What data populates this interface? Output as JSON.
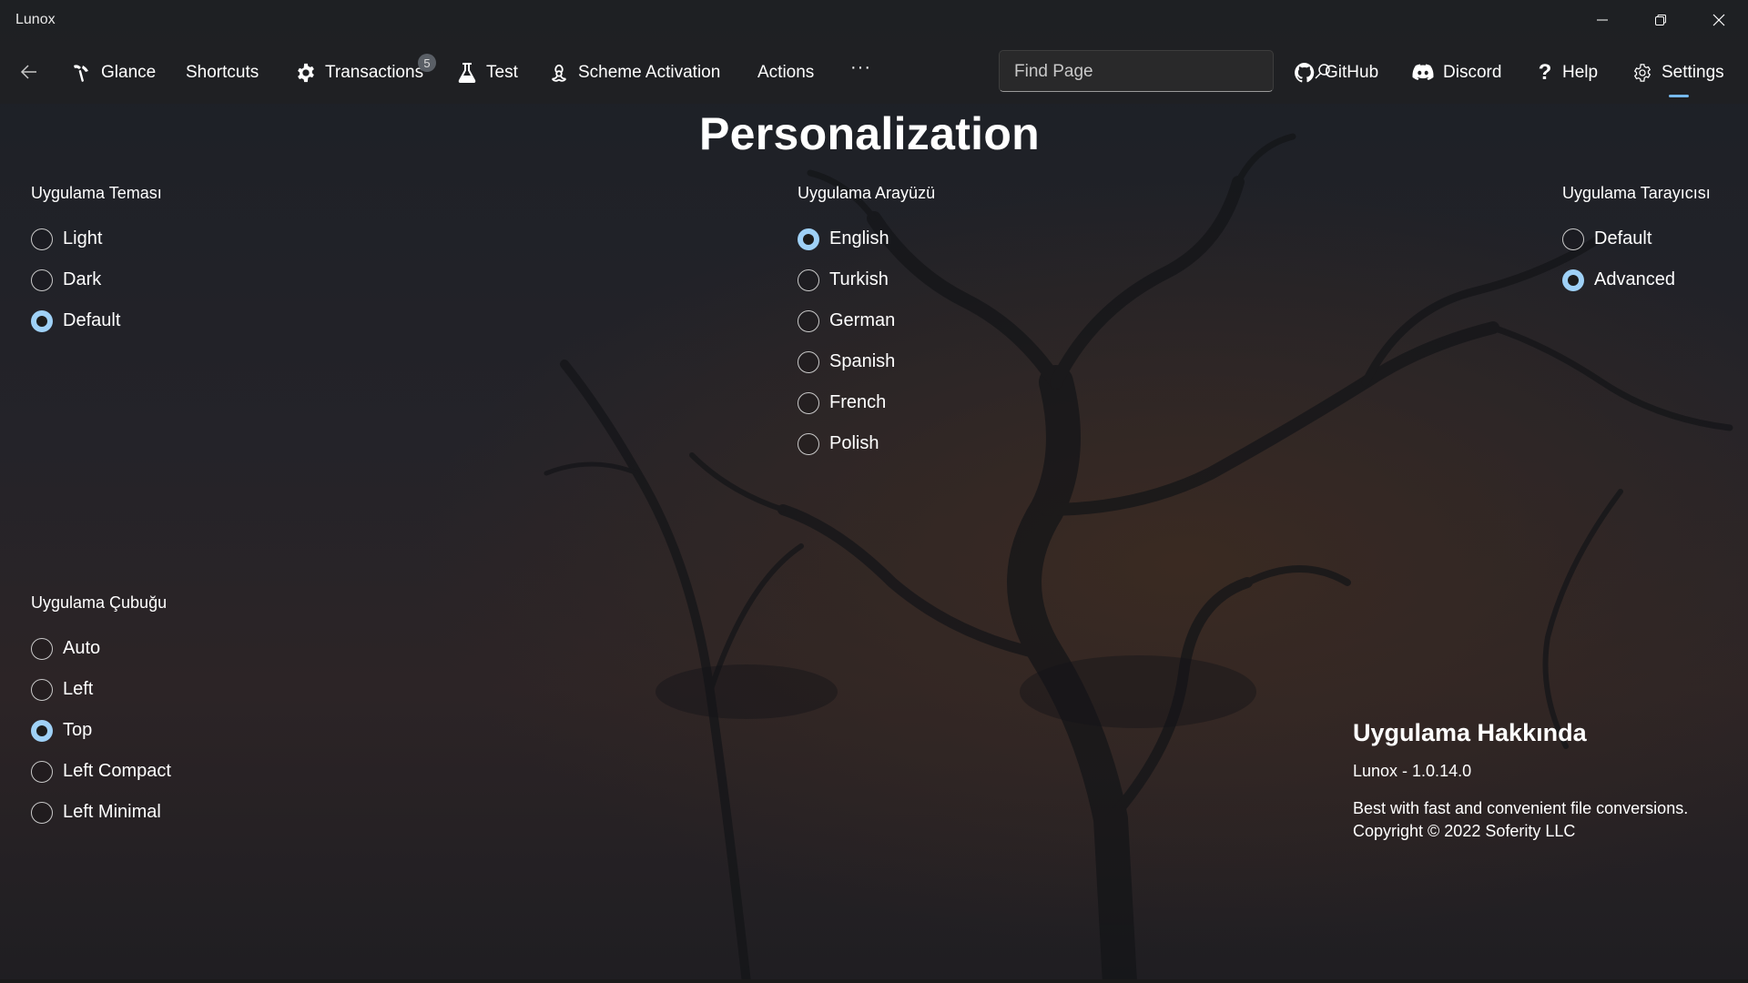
{
  "window": {
    "title": "Lunox"
  },
  "nav": {
    "items": [
      {
        "label": "Glance",
        "icon": "glance-icon"
      },
      {
        "label": "Shortcuts",
        "icon": ""
      },
      {
        "label": "Transactions",
        "icon": "gear-cog-icon",
        "badge": "5"
      },
      {
        "label": "Test",
        "icon": "flask-icon"
      },
      {
        "label": "Scheme Activation",
        "icon": "biohazard-icon"
      },
      {
        "label": "Actions",
        "icon": ""
      },
      {
        "label": "···",
        "icon": "more-icon"
      }
    ],
    "search_placeholder": "Find Page",
    "right_items": [
      {
        "label": "GitHub",
        "icon": "github-icon"
      },
      {
        "label": "Discord",
        "icon": "discord-icon"
      },
      {
        "label": "Help",
        "icon": "question-icon"
      },
      {
        "label": "Settings",
        "icon": "settings-gear-icon",
        "selected": true
      }
    ]
  },
  "page": {
    "title": "Personalization"
  },
  "groups": {
    "theme": {
      "label": "Uygulama Teması",
      "options": [
        "Light",
        "Dark",
        "Default"
      ],
      "selected": "Default"
    },
    "language": {
      "label": "Uygulama Arayüzü",
      "options": [
        "English",
        "Turkish",
        "German",
        "Spanish",
        "French",
        "Polish"
      ],
      "selected": "English"
    },
    "browser": {
      "label": "Uygulama Tarayıcısı",
      "options": [
        "Default",
        "Advanced"
      ],
      "selected": "Advanced"
    },
    "bar": {
      "label": "Uygulama Çubuğu",
      "options": [
        "Auto",
        "Left",
        "Top",
        "Left Compact",
        "Left Minimal"
      ],
      "selected": "Top"
    }
  },
  "about": {
    "title": "Uygulama Hakkında",
    "version": "Lunox - 1.0.14.0",
    "description": "Best with fast and convenient file conversions.",
    "copyright": "Copyright © 2022 Soferity LLC"
  },
  "colors": {
    "accent": "#9fd1f7",
    "nav_selected_indicator": "#76b9ed",
    "background": "#22232a"
  }
}
